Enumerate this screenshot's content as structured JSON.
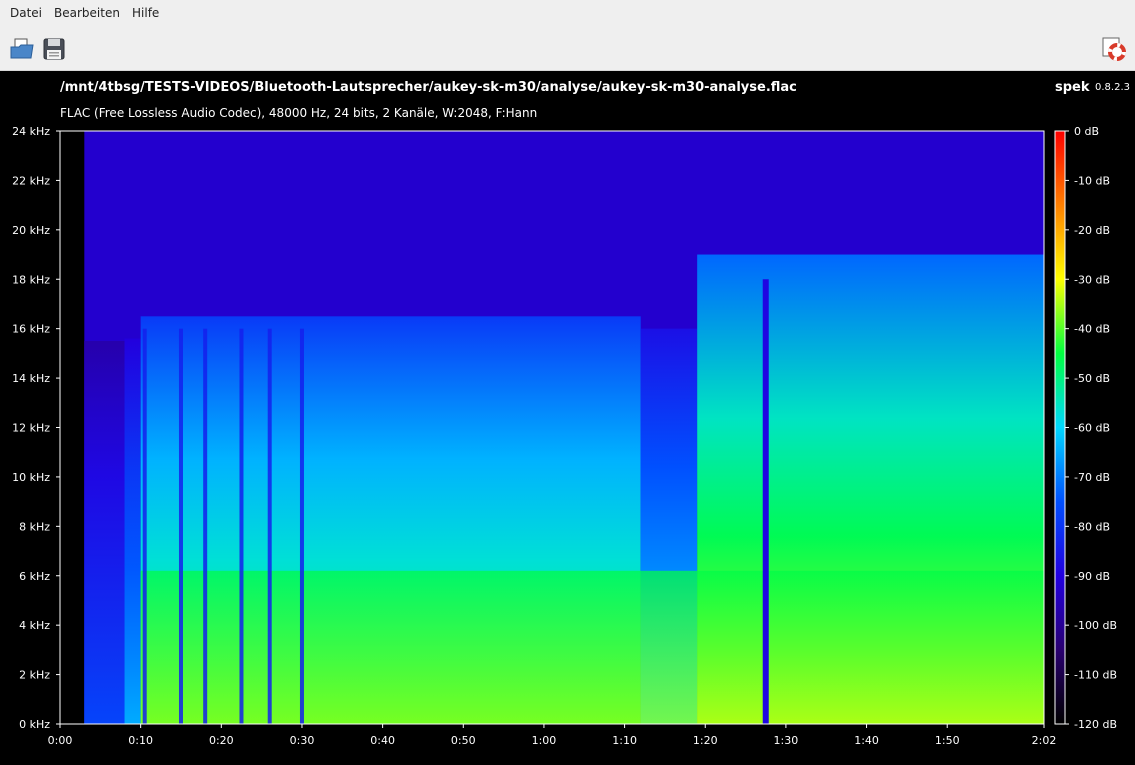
{
  "menu": {
    "file": "Datei",
    "edit": "Bearbeiten",
    "help": "Hilfe"
  },
  "toolbar": {
    "open_icon": "open-file-icon",
    "save_icon": "save-icon",
    "about_icon": "lifebuoy-help-icon"
  },
  "header": {
    "file_path": "/mnt/4tbsg/TESTS-VIDEOS/Bluetooth-Lautsprecher/aukey-sk-m30/analyse/aukey-sk-m30-analyse.flac",
    "app_name": "spek",
    "app_version": "0.8.2.3",
    "info": "FLAC (Free Lossless Audio Codec), 48000 Hz, 24 bits, 2 Kanäle, W:2048, F:Hann"
  },
  "chart_data": {
    "type": "heatmap",
    "y_unit": "kHz",
    "ylim": [
      0,
      24
    ],
    "y_ticks": [
      "0 kHz",
      "2 kHz",
      "4 kHz",
      "6 kHz",
      "8 kHz",
      "10 kHz",
      "12 kHz",
      "14 kHz",
      "16 kHz",
      "18 kHz",
      "20 kHz",
      "22 kHz",
      "24 kHz"
    ],
    "xlim_seconds": [
      0,
      122
    ],
    "x_ticks": [
      "0:00",
      "0:10",
      "0:20",
      "0:30",
      "0:40",
      "0:50",
      "1:00",
      "1:10",
      "1:20",
      "1:30",
      "1:40",
      "1:50",
      "2:02"
    ],
    "colorbar_ticks": [
      "0 dB",
      "-10 dB",
      "-20 dB",
      "-30 dB",
      "-40 dB",
      "-50 dB",
      "-60 dB",
      "-70 dB",
      "-80 dB",
      "-90 dB",
      "-100 dB",
      "-110 dB",
      "-120 dB"
    ],
    "colorbar_range_db": [
      -120,
      0
    ],
    "colormap": [
      "#000000",
      "#2a0070",
      "#2200e0",
      "#0050ff",
      "#00d8ff",
      "#00ff40",
      "#ffff00",
      "#ff8000",
      "#ff0000"
    ],
    "audio_start_seconds": 3,
    "segments": [
      {
        "t0": 3,
        "t1": 8,
        "cutoff_khz": 15.5,
        "level": 0.35
      },
      {
        "t0": 8,
        "t1": 10,
        "cutoff_khz": 15.6,
        "level": 0.45
      },
      {
        "t0": 10,
        "t1": 72,
        "cutoff_khz": 16.5,
        "level": 0.62
      },
      {
        "t0": 72,
        "t1": 79,
        "cutoff_khz": 16.0,
        "level": 0.5
      },
      {
        "t0": 79,
        "t1": 122,
        "cutoff_khz": 19.0,
        "level": 0.72
      }
    ],
    "gaps_seconds": [
      10.5,
      15,
      18,
      22.5,
      26,
      30
    ],
    "dropout_seconds": [
      87.5
    ]
  }
}
